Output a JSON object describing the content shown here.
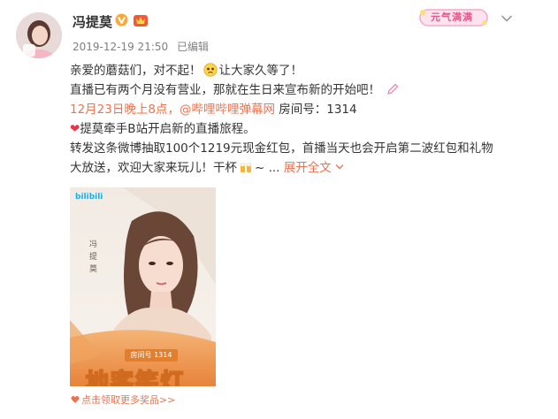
{
  "post": {
    "author": {
      "name": "冯提莫"
    },
    "meta": {
      "time": "2019-12-19 21:50",
      "edited": "已编辑"
    },
    "sticker_text": "元气满满",
    "content": {
      "line1": {
        "a": "亲爱的蘑菇们，对不起！",
        "b": "让大家久等了！"
      },
      "line2": "直播已有两个月没有营业，那就在生日来宣布新的开始吧！",
      "line3": {
        "time": "12月23日晚上8点，",
        "mention": "@哔哩哔哩弹幕网",
        "room": "房间号：1314"
      },
      "line4": "提莫牵手B站开启新的直播旅程。",
      "line5": "转发这条微博抽取100个1219元现金红包，首播当天也会开启第二波红包和礼物",
      "line6": {
        "text": "大放送，欢迎大家来玩儿！干杯",
        "tail": "~ ...",
        "expand": "展开全文"
      }
    },
    "poster": {
      "logo": "bilibili",
      "name_vertical": "冯 提 莫",
      "room": "房间号 1314",
      "slogan": "地客笑灯"
    },
    "bonus_link": "点击领取更多奖品>>"
  },
  "colors": {
    "link": "#eb7350",
    "text": "#333333",
    "meta": "#808080"
  }
}
